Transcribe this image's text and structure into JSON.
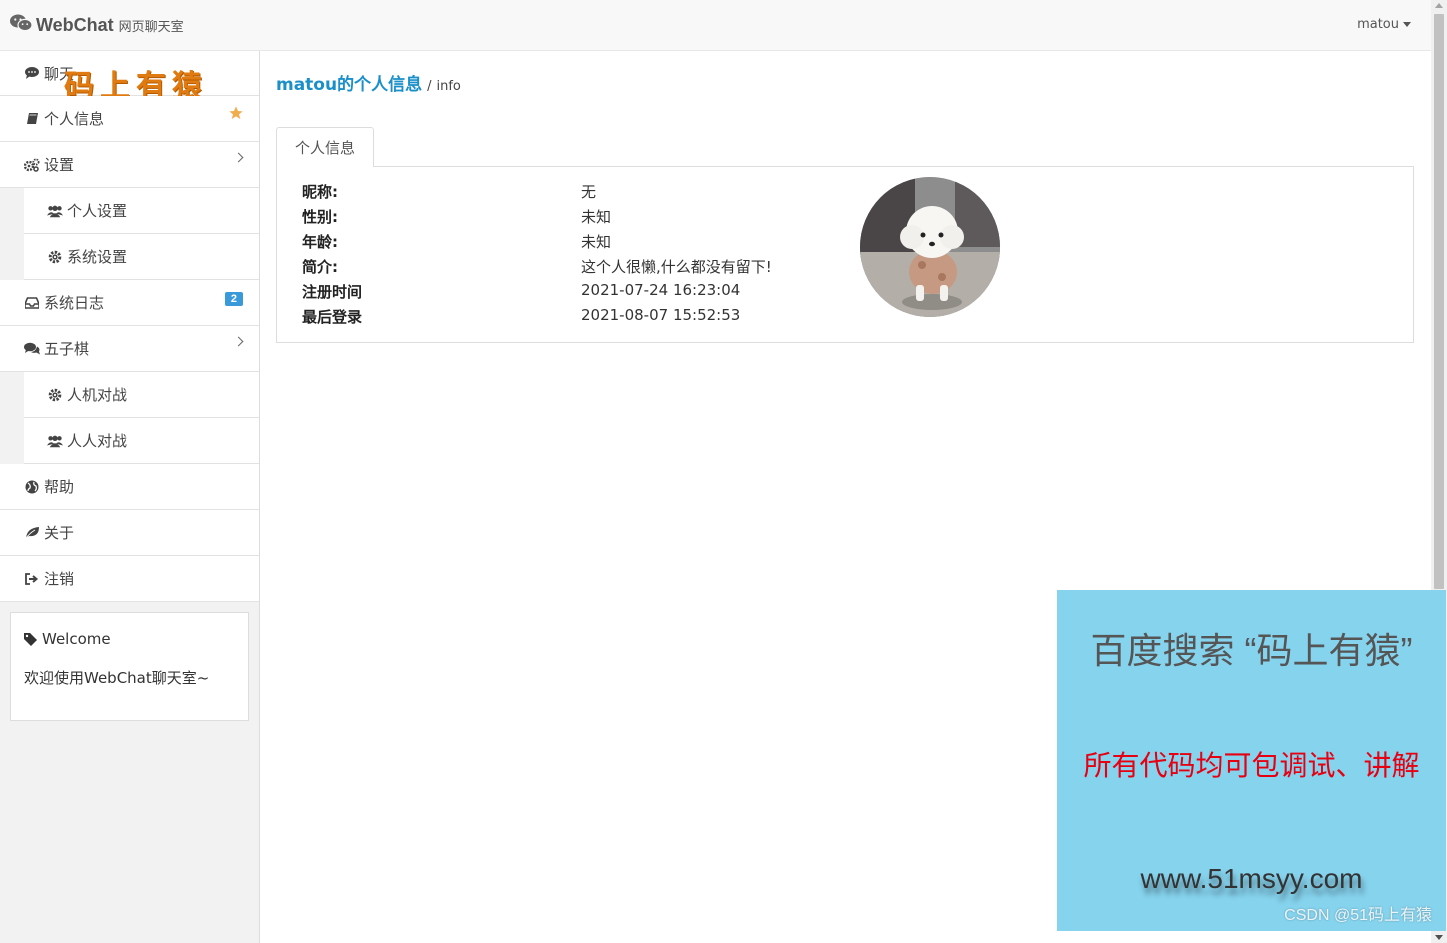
{
  "navbar": {
    "brand_title": "WebChat",
    "brand_sub": "网页聊天室",
    "user": "matou"
  },
  "sidebar": {
    "items": [
      {
        "label": "聊天",
        "icon": "comment-icon"
      },
      {
        "label": "个人信息",
        "icon": "book-icon"
      },
      {
        "label": "设置",
        "icon": "gears-icon"
      },
      {
        "label": "个人设置",
        "icon": "users-icon"
      },
      {
        "label": "系统设置",
        "icon": "gear-icon"
      },
      {
        "label": "系统日志",
        "icon": "inbox-icon",
        "badge": "2"
      },
      {
        "label": "五子棋",
        "icon": "comments-icon"
      },
      {
        "label": "人机对战",
        "icon": "gear-icon"
      },
      {
        "label": "人人对战",
        "icon": "users-icon"
      },
      {
        "label": "帮助",
        "icon": "globe-icon"
      },
      {
        "label": "关于",
        "icon": "leaf-icon"
      },
      {
        "label": "注销",
        "icon": "sign-out-icon"
      }
    ],
    "overlay_text": "码上有猿",
    "welcome": {
      "title": "Welcome",
      "text": "欢迎使用WebChat聊天室~"
    }
  },
  "main": {
    "title": "matou的个人信息",
    "separator": "/",
    "subtitle": "info",
    "tab_label": "个人信息",
    "info": [
      {
        "label": "昵称:",
        "value": "无"
      },
      {
        "label": "性别:",
        "value": "未知"
      },
      {
        "label": "年龄:",
        "value": "未知"
      },
      {
        "label": "简介:",
        "value": "这个人很懒,什么都没有留下!"
      },
      {
        "label": "注册时间",
        "value": "2021-07-24 16:23:04"
      },
      {
        "label": "最后登录",
        "value": "2021-08-07 15:52:53"
      }
    ]
  },
  "ad": {
    "line1": "百度搜索 “码上有猿”",
    "line2": "所有代码均可包调试、讲解",
    "url": "www.51msyy.com",
    "watermark": "CSDN @51码上有猿"
  },
  "colors": {
    "accent": "#1a8fc9",
    "badge": "#3a9ad9",
    "star": "#f0ad4e",
    "ad_bg": "#86d3ee",
    "ad_red": "#e60012"
  }
}
